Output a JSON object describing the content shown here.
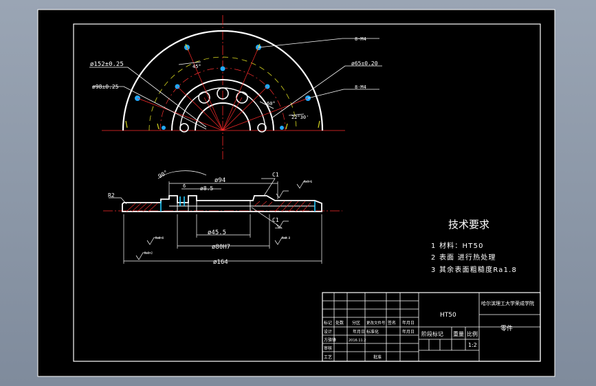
{
  "dims": {
    "d152": "ø152±0.25",
    "d98": "ø98±0.25",
    "d65": "ø65±0.20",
    "holes_top": "8-M4",
    "holes_mid": "8-M4",
    "ang45": "45°",
    "ang60": "60°",
    "ang2230": "22°30'",
    "ang90": "90°",
    "d94": "ø94",
    "d85": "ø8.5",
    "d455": "ø45.5",
    "d80": "ø80H7",
    "d164": "ø164",
    "c1a": "C1",
    "c1b": "C1",
    "r2": "R2",
    "six": "6",
    "rough1": "Ra0.8",
    "rough2": "Ra3.2",
    "rough3": "Ra0.8",
    "rough4": "Ra1.6"
  },
  "tech": {
    "title": "技术要求",
    "req1": "1 材料：HT50",
    "req2": "2 表面 进行热处理",
    "req3": "3 其余表面粗糙度Ra1.8"
  },
  "titleblock": {
    "material": "HT50",
    "school": "哈尔滨理工大学荣成学院",
    "part_name": "零件",
    "stage_label": "阶段标记",
    "weight_label": "重量",
    "scale_label": "比例",
    "scale": "1:2",
    "row1": [
      "标记",
      "处数",
      "分区",
      "更改文件号",
      "签名",
      "年月日"
    ],
    "design_label": "设计",
    "design_name": "",
    "std_label": "标准化",
    "date_label": "年月日",
    "date_value": "2016.11.2",
    "check_label": "审核",
    "process_label": "工艺",
    "approve_label": "批准",
    "drawer": "方骆锋"
  }
}
